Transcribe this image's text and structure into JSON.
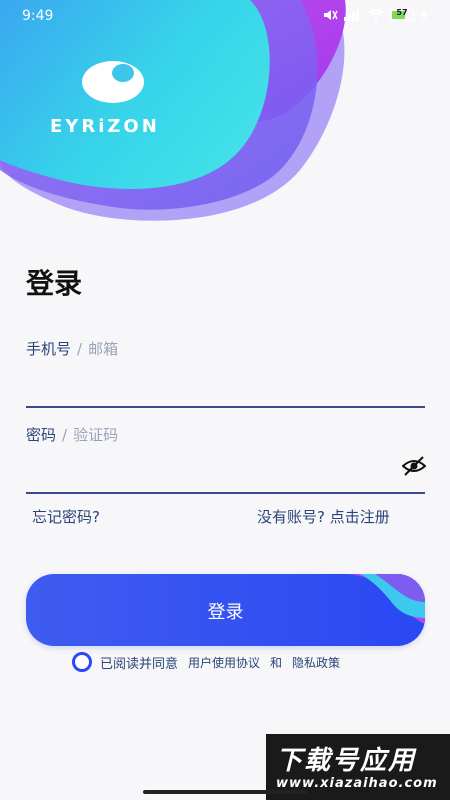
{
  "status": {
    "time": "9:49",
    "battery": "57",
    "icons": [
      "mute-icon",
      "signal-icon",
      "wifi-icon",
      "battery-icon",
      "charging-icon"
    ]
  },
  "brand": {
    "name": "EYRiZON"
  },
  "title": "登录",
  "phone_field": {
    "label": "手机号",
    "separator": "/",
    "alt_label": "邮箱",
    "value": ""
  },
  "password_field": {
    "label": "密码",
    "separator": "/",
    "alt_label": "验证码",
    "value": ""
  },
  "links": {
    "forgot_password": "忘记密码?",
    "no_account": "没有账号? 点击注册"
  },
  "login_button": {
    "label": "登录"
  },
  "agreement": {
    "prefix": "已阅读并同意",
    "user_agreement": "用户使用协议",
    "and": "和",
    "privacy_policy": "隐私政策"
  },
  "watermark": {
    "title": "下载号应用",
    "url": "www.xiazaihao.com"
  },
  "colors": {
    "accent": "#2a48f3",
    "text_link": "#2b4478",
    "header_cyan": "#3ed4ea",
    "header_purple": "#8a5cf0"
  }
}
